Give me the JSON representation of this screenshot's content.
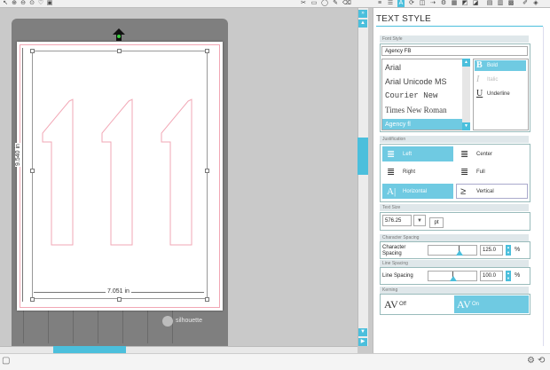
{
  "toolbar": {
    "left_icons": [
      "cursor-icon",
      "zoom-in-icon",
      "zoom-out-icon",
      "zoom-fit-icon",
      "heart-icon",
      "shapes-icon"
    ],
    "right_icons": [
      "knife-icon",
      "rectangle-icon",
      "ellipse-icon",
      "pen-icon",
      "eraser-icon",
      "align-icon",
      "rotate-icon",
      "text-icon",
      "store-icon",
      "send-icon",
      "settings-icon",
      "fill-icon",
      "line-icon",
      "shadow-icon",
      "color-icon"
    ]
  },
  "canvas": {
    "height_dim": "9.540 in",
    "width_dim": "7.051 in",
    "brand": "silhouette"
  },
  "panel": {
    "title": "TEXT STYLE",
    "font_style": {
      "header": "Font Style",
      "current_font": "Agency FB",
      "fonts": [
        {
          "name": "Arial",
          "selected": false
        },
        {
          "name": "Arial Unicode MS",
          "selected": false
        },
        {
          "name": "Courier New",
          "selected": false
        },
        {
          "name": "Times New Roman",
          "selected": false
        },
        {
          "name": "Agency fl",
          "selected": true
        }
      ],
      "styles": [
        {
          "glyph": "B",
          "name": "Bold",
          "selected": true
        },
        {
          "glyph": "I",
          "name": "Italic",
          "selected": false
        },
        {
          "glyph": "U",
          "name": "Underline",
          "selected": false
        }
      ]
    },
    "justification": {
      "header": "Justification",
      "left": "Left",
      "center": "Center",
      "right": "Right",
      "full": "Full",
      "horizontal": "Horizontal",
      "vertical": "Vertical"
    },
    "text_size": {
      "header": "Text Size",
      "value": "576.25",
      "unit": "pt"
    },
    "character_spacing": {
      "header": "Character Spacing",
      "label": "Character Spacing",
      "value": "125.0",
      "unit": "%"
    },
    "line_spacing": {
      "header": "Line Spacing",
      "label": "Line Spacing",
      "value": "100.0",
      "unit": "%"
    },
    "kerning": {
      "header": "Kerning",
      "off": "Off",
      "on": "On"
    }
  },
  "colors": {
    "accent": "#4bbfdc",
    "selected": "#6fcae2",
    "cut_line": "#f2a7b5",
    "mat": "#7f7f7f"
  }
}
